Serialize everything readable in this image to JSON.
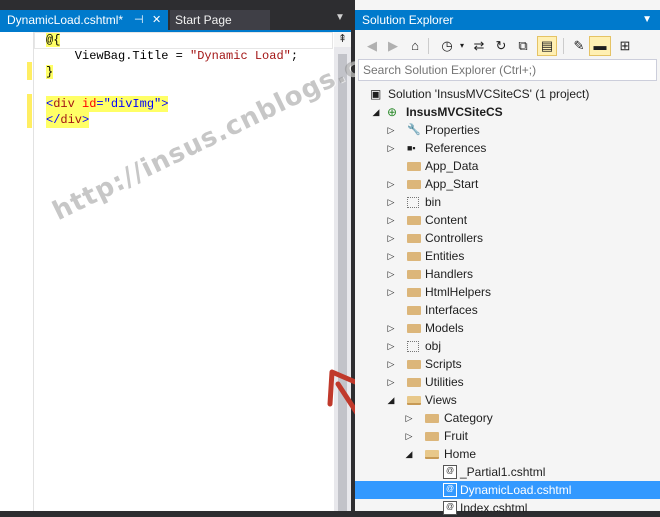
{
  "editor": {
    "tabs": [
      {
        "label": "DynamicLoad.cshtml*",
        "pin_glyph": "⊣",
        "close_glyph": "✕"
      },
      {
        "label": "Start Page"
      }
    ],
    "overflow_glyph": "▼",
    "split_glyph": "⇞",
    "code_lines": [
      {
        "segments": [
          {
            "t": "@{",
            "c": "razor"
          }
        ]
      },
      {
        "segments": [
          {
            "t": "    ViewBag.Title = ",
            "c": ""
          },
          {
            "t": "\"Dynamic Load\"",
            "c": "strred"
          },
          {
            "t": ";",
            "c": ""
          }
        ]
      },
      {
        "segments": [
          {
            "t": "}",
            "c": "razor"
          }
        ]
      },
      {
        "segments": []
      },
      {
        "segments": [
          {
            "t": "<",
            "c": "str"
          },
          {
            "t": "div",
            "c": "kw"
          },
          {
            "t": " ",
            "c": ""
          },
          {
            "t": "id",
            "c": "attr"
          },
          {
            "t": "=\"divImg\"",
            "c": "str"
          },
          {
            "t": ">",
            "c": "str"
          }
        ]
      },
      {
        "segments": [
          {
            "t": "</",
            "c": "str"
          },
          {
            "t": "div",
            "c": "kw"
          },
          {
            "t": ">",
            "c": "str"
          }
        ]
      }
    ]
  },
  "watermark": "http://insus.cnblogs.com",
  "solution_explorer": {
    "title": "Solution Explorer",
    "dropdown_glyph": "▼",
    "search_placeholder": "Search Solution Explorer (Ctrl+;)",
    "toolbar_icons": [
      "back-icon",
      "forward-icon",
      "home-icon",
      "history-icon",
      "sync-icon",
      "refresh-icon",
      "collapse-all-icon",
      "show-all-files-icon",
      "properties-icon",
      "preview-icon",
      "class-view-icon"
    ],
    "tree": [
      {
        "label": "Solution 'InsusMVCSiteCS' (1 project)",
        "level": 0,
        "icon": "solution",
        "expander": ""
      },
      {
        "label": "InsusMVCSiteCS",
        "level": 1,
        "icon": "project",
        "expander": "◢",
        "bold": true
      },
      {
        "label": "Properties",
        "level": 2,
        "icon": "wrench",
        "expander": "▷"
      },
      {
        "label": "References",
        "level": 2,
        "icon": "references",
        "expander": "▷"
      },
      {
        "label": "App_Data",
        "level": 2,
        "icon": "folder",
        "expander": ""
      },
      {
        "label": "App_Start",
        "level": 2,
        "icon": "folder",
        "expander": "▷"
      },
      {
        "label": "bin",
        "level": 2,
        "icon": "dotted",
        "expander": "▷"
      },
      {
        "label": "Content",
        "level": 2,
        "icon": "folder",
        "expander": "▷"
      },
      {
        "label": "Controllers",
        "level": 2,
        "icon": "folder",
        "expander": "▷"
      },
      {
        "label": "Entities",
        "level": 2,
        "icon": "folder",
        "expander": "▷"
      },
      {
        "label": "Handlers",
        "level": 2,
        "icon": "folder",
        "expander": "▷"
      },
      {
        "label": "HtmlHelpers",
        "level": 2,
        "icon": "folder",
        "expander": "▷"
      },
      {
        "label": "Interfaces",
        "level": 2,
        "icon": "folder",
        "expander": ""
      },
      {
        "label": "Models",
        "level": 2,
        "icon": "folder",
        "expander": "▷"
      },
      {
        "label": "obj",
        "level": 2,
        "icon": "dotted",
        "expander": "▷"
      },
      {
        "label": "Scripts",
        "level": 2,
        "icon": "folder",
        "expander": "▷"
      },
      {
        "label": "Utilities",
        "level": 2,
        "icon": "folder",
        "expander": "▷"
      },
      {
        "label": "Views",
        "level": 2,
        "icon": "folder-open",
        "expander": "◢"
      },
      {
        "label": "Category",
        "level": 3,
        "icon": "folder",
        "expander": "▷"
      },
      {
        "label": "Fruit",
        "level": 3,
        "icon": "folder",
        "expander": "▷"
      },
      {
        "label": "Home",
        "level": 3,
        "icon": "folder-open",
        "expander": "◢"
      },
      {
        "label": "_Partial1.cshtml",
        "level": 4,
        "icon": "cshtml",
        "expander": ""
      },
      {
        "label": "DynamicLoad.cshtml",
        "level": 4,
        "icon": "cshtml",
        "expander": "",
        "selected": true
      },
      {
        "label": "Index.cshtml",
        "level": 4,
        "icon": "cshtml",
        "expander": ""
      }
    ]
  },
  "colors": {
    "accent": "#007acc",
    "selection": "#3399ff",
    "highlight": "#ffff66",
    "arrow": "#c0392b"
  }
}
